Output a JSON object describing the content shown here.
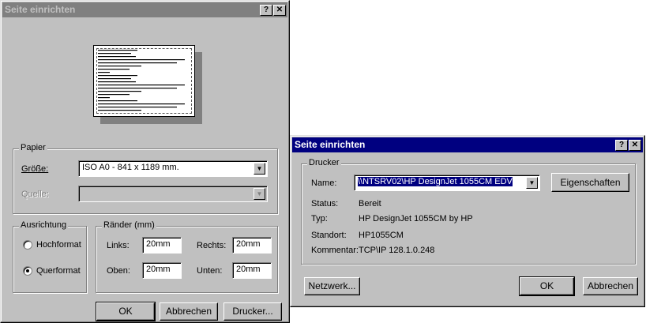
{
  "dialog1": {
    "title": "Seite einrichten",
    "help_btn": "?",
    "close_btn": "✕",
    "papier": {
      "group_label": "Papier",
      "size_label": "Größe:",
      "size_value": "ISO A0 - 841 x 1189 mm.",
      "source_label": "Quelle:",
      "source_value": ""
    },
    "ausrichtung": {
      "group_label": "Ausrichtung",
      "options": [
        "Hochformat",
        "Querformat"
      ],
      "selected": "Querformat"
    },
    "raender": {
      "group_label": "Ränder (mm)",
      "links_label": "Links:",
      "links_value": "20mm",
      "rechts_label": "Rechts:",
      "rechts_value": "20mm",
      "oben_label": "Oben:",
      "oben_value": "20mm",
      "unten_label": "Unten:",
      "unten_value": "20mm"
    },
    "buttons": {
      "ok": "OK",
      "abbrechen": "Abbrechen",
      "drucker": "Drucker..."
    }
  },
  "dialog2": {
    "title": "Seite einrichten",
    "help_btn": "?",
    "close_btn": "✕",
    "drucker": {
      "group_label": "Drucker",
      "name_label": "Name:",
      "name_value": "\\\\NTSRV02\\HP DesignJet 1055CM EDV",
      "eigenschaften": "Eigenschaften",
      "status_label": "Status:",
      "status_value": "Bereit",
      "typ_label": "Typ:",
      "typ_value": "HP DesignJet 1055CM by HP",
      "standort_label": "Standort:",
      "standort_value": "HP1055CM",
      "kommentar_label": "Kommentar:",
      "kommentar_value": "TCP\\IP 128.1.0.248"
    },
    "buttons": {
      "netzwerk": "Netzwerk...",
      "ok": "OK",
      "abbrechen": "Abbrechen"
    }
  }
}
